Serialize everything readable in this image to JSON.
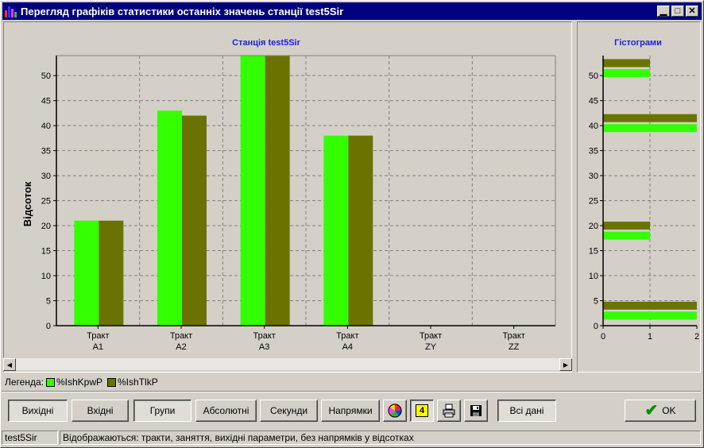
{
  "window": {
    "title": "Перегляд графіків статистики останніх значень станції test5Sir"
  },
  "main_chart": {
    "title": "Станція test5Sir",
    "ylabel": "Відсоток",
    "ylim": [
      0,
      54
    ],
    "yticks": [
      0,
      5,
      10,
      15,
      20,
      25,
      30,
      35,
      40,
      45,
      50
    ],
    "categories": [
      [
        "Тракт",
        "A1"
      ],
      [
        "Тракт",
        "A2"
      ],
      [
        "Тракт",
        "A3"
      ],
      [
        "Тракт",
        "A4"
      ],
      [
        "Тракт",
        "ZY"
      ],
      [
        "Тракт",
        "ZZ"
      ]
    ]
  },
  "hist_chart": {
    "title": "Гістограми",
    "xticks": [
      "0",
      "1",
      "2"
    ]
  },
  "chart_data": [
    {
      "type": "bar",
      "title": "Станція test5Sir",
      "xlabel": "",
      "ylabel": "Відсоток",
      "ylim": [
        0,
        54
      ],
      "grid": true,
      "categories": [
        "Тракт A1",
        "Тракт A2",
        "Тракт A3",
        "Тракт A4",
        "Тракт ZY",
        "Тракт ZZ"
      ],
      "series": [
        {
          "name": "%IshKpwP",
          "color": "#33ff00",
          "values": [
            21,
            43,
            54,
            38,
            0,
            0
          ]
        },
        {
          "name": "%IshTlkP",
          "color": "#6b7300",
          "values": [
            21,
            42,
            54,
            38,
            0,
            0
          ]
        }
      ]
    },
    {
      "type": "bar",
      "orientation": "horizontal",
      "title": "Гістограми",
      "xlim": [
        0,
        2
      ],
      "ylim": [
        0,
        54
      ],
      "grid": true,
      "bins": [
        {
          "y": 2,
          "series": "%IshKpwP",
          "count": 2
        },
        {
          "y": 4,
          "series": "%IshTlkP",
          "count": 2
        },
        {
          "y": 18,
          "series": "%IshKpwP",
          "count": 1
        },
        {
          "y": 20,
          "series": "%IshTlkP",
          "count": 1
        },
        {
          "y": 39.5,
          "series": "%IshKpwP",
          "count": 2
        },
        {
          "y": 41.5,
          "series": "%IshTlkP",
          "count": 2
        },
        {
          "y": 50.5,
          "series": "%IshKpwP",
          "count": 1
        },
        {
          "y": 52.5,
          "series": "%IshTlkP",
          "count": 1
        }
      ]
    }
  ],
  "legend": {
    "label": "Легенда:",
    "items": [
      {
        "name": "%IshKpwP",
        "color": "#33ff00"
      },
      {
        "name": "%IshTlkP",
        "color": "#6b7300"
      }
    ]
  },
  "toolbar": {
    "outputs": "Вихідні",
    "inputs": "Вхідні",
    "groups": "Групи",
    "absolute": "Абсолютні",
    "seconds": "Секунди",
    "directions": "Напрямки",
    "count_badge": "4",
    "all_data": "Всі дані",
    "ok": "OK"
  },
  "status": {
    "station": "test5Sir",
    "message": "Відображаються: тракти, заняття, вихідні параметри, без напрямків у відсотках"
  }
}
